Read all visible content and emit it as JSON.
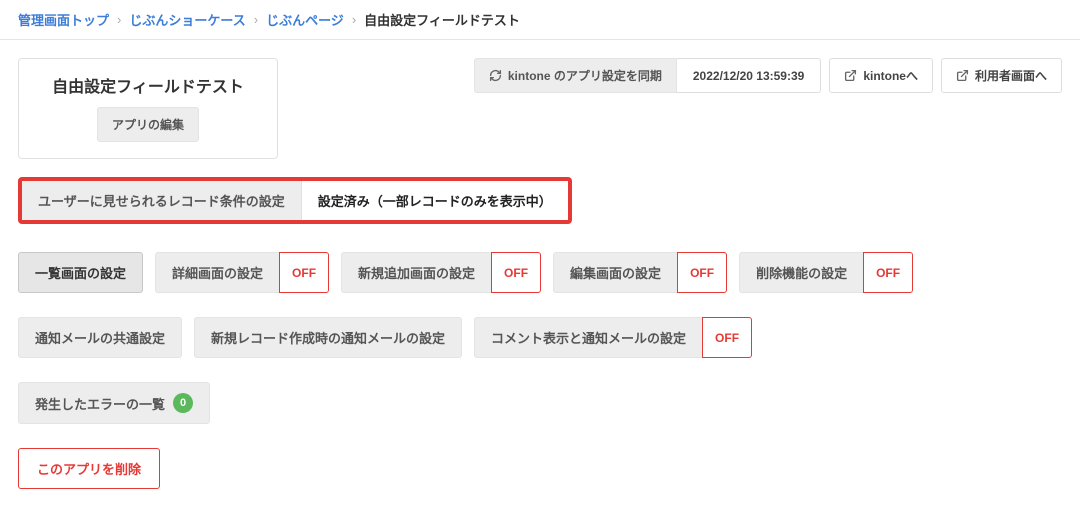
{
  "breadcrumbs": {
    "items": [
      "管理画面トップ",
      "じぶんショーケース",
      "じぶんページ"
    ],
    "current": "自由設定フィールドテスト"
  },
  "titleCard": {
    "title": "自由設定フィールドテスト",
    "editButton": "アプリの編集"
  },
  "headerActions": {
    "syncLabel": "kintone のアプリ設定を同期",
    "syncTime": "2022/12/20 13:59:39",
    "kintoneLink": "kintoneへ",
    "userScreenLink": "利用者画面へ"
  },
  "recordCondition": {
    "label": "ユーザーに見せられるレコード条件の設定",
    "status": "設定済み（一部レコードのみを表示中）"
  },
  "tabRow1": {
    "listScreen": "一覧画面の設定",
    "detailScreen": "詳細画面の設定",
    "addScreen": "新規追加画面の設定",
    "editScreen": "編集画面の設定",
    "deleteFeature": "削除機能の設定",
    "offBadge": "OFF"
  },
  "tabRow2": {
    "notifyCommon": "通知メールの共通設定",
    "notifyNewRecord": "新規レコード作成時の通知メールの設定",
    "notifyComment": "コメント表示と通知メールの設定",
    "offBadge": "OFF"
  },
  "errorRow": {
    "label": "発生したエラーの一覧",
    "count": "0"
  },
  "deleteApp": {
    "label": "このアプリを削除"
  }
}
